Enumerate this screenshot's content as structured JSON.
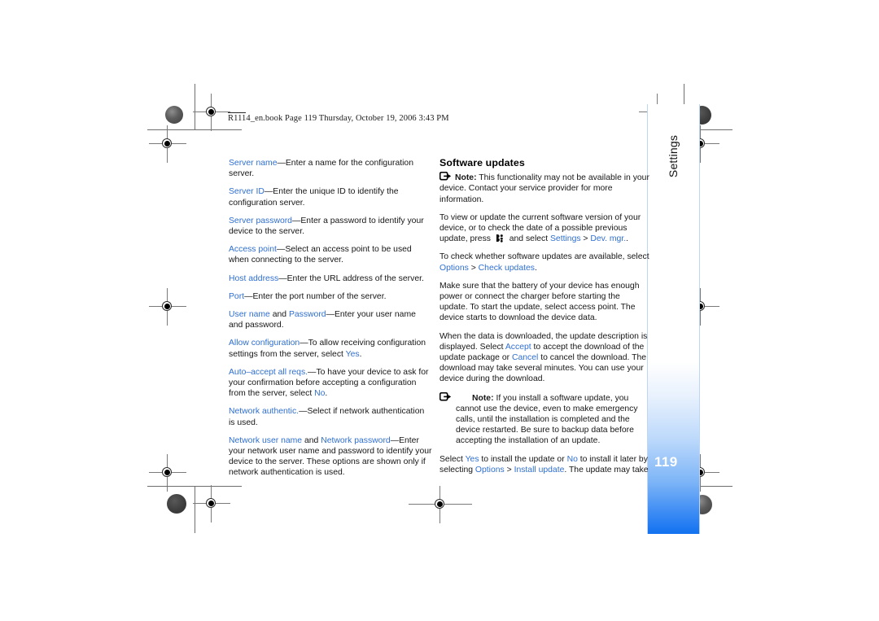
{
  "document": {
    "slug": "R1114_en.book  Page 119  Thursday, October 19, 2006  3:43 PM",
    "page_number": "119",
    "side_tab_label": "Settings",
    "link_color": "#2f6fd0",
    "tab_accent_color": "#1272f0"
  },
  "left_column": {
    "entries": [
      {
        "term": "Server name",
        "rest": "—Enter a name for the configuration server."
      },
      {
        "term": "Server ID",
        "rest": "—Enter the unique ID to identify the configuration server."
      },
      {
        "term": "Server password",
        "rest": "—Enter a password to identify your device to the server."
      },
      {
        "term": "Access point",
        "rest": "—Select an access point to be used when connecting to the server."
      },
      {
        "term": "Host address",
        "rest": "—Enter the URL address of the server."
      },
      {
        "term": "Port",
        "rest": "—Enter the port number of the server."
      }
    ],
    "user_name_entry": {
      "term1": "User name",
      "conjunction": " and ",
      "term2": "Password",
      "rest": "—Enter your user name and password."
    },
    "allow_configuration": {
      "term": "Allow configuration",
      "text_before": "—To allow receiving configuration settings from the server, select ",
      "value": "Yes",
      "text_after": "."
    },
    "auto_accept": {
      "term": "Auto–accept all reqs.",
      "text_before": "—To have your device to ask for your confirmation before accepting a configuration from the server, select ",
      "value": "No",
      "text_after": "."
    },
    "network_authentic": {
      "term": "Network authentic.",
      "rest": "—Select if network authentication is used."
    },
    "network_credentials": {
      "term1": "Network user name",
      "conjunction": " and ",
      "term2": "Network password",
      "rest": "—Enter your network user name and password to identify your device to the server. These options are shown only if network authentication is used."
    }
  },
  "right_column": {
    "heading": "Software updates",
    "note_1": {
      "label": "Note:",
      "text": " This functionality may not be available in your device. Contact your service provider for more information."
    },
    "para_view_update": {
      "text_before": "To view or update the current software version of your device, or to check the date of a possible previous update, press ",
      "text_mid": " and select ",
      "link1": "Settings",
      "separator": " > ",
      "link2": "Dev. mgr.",
      "text_after": "."
    },
    "para_check_updates": {
      "text_before": "To check whether software updates are available, select ",
      "link1": "Options",
      "separator": " > ",
      "link2": "Check updates",
      "text_after": "."
    },
    "para_battery": {
      "text": "Make sure that the battery of your device has enough power or connect the charger before starting the update. To start the update, select access point. The device starts to download the device data."
    },
    "para_downloaded": {
      "text_before": "When the data is downloaded, the update description is displayed. Select ",
      "link1": "Accept",
      "text_mid": " to accept the download of the update package or ",
      "link2": "Cancel",
      "text_after": " to cancel the download. The download may take several minutes. You can use your device during the download."
    },
    "note_2": {
      "label": "Note:",
      "text": " If you install a software update, you cannot use the device, even to make emergency calls, until the installation is completed and the device restarted. Be sure to backup data before accepting the installation of an update."
    },
    "para_select_yes": {
      "text_before": "Select ",
      "link1": "Yes",
      "text_mid1": " to install the update or ",
      "link2": "No",
      "text_mid2": " to install it later by selecting ",
      "link3": "Options",
      "separator": " > ",
      "link4": "Install update",
      "text_after": ". The update may take"
    }
  }
}
